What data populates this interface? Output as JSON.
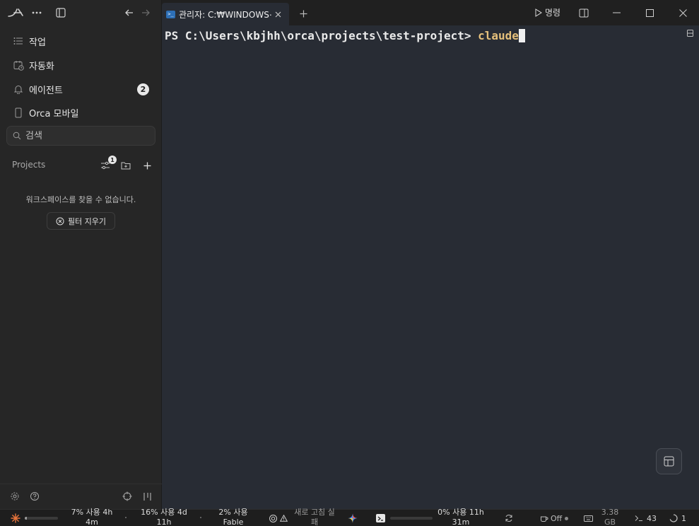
{
  "window": {
    "tab_title": "관리자: C:₩WINDOWS⋯",
    "run_label": "명령"
  },
  "sidebar": {
    "items": [
      {
        "label": "작업",
        "icon": "list-icon"
      },
      {
        "label": "자동화",
        "icon": "calendar-clock-icon"
      },
      {
        "label": "에이전트",
        "icon": "bell-icon",
        "badge": "2"
      },
      {
        "label": "Orca 모바일",
        "icon": "mobile-icon"
      }
    ],
    "search_placeholder": "검색",
    "projects_label": "Projects",
    "filter_badge": "1",
    "empty_message": "워크스페이스를 찾을 수 없습니다.",
    "clear_filter_label": "필터 지우기"
  },
  "terminal": {
    "prompt": "PS C:\\Users\\kbjhh\\orca\\projects\\test-project> ",
    "command": "claude"
  },
  "statusbar": {
    "usage1_line1": "7% 사용 4h",
    "usage1_line2": "4m",
    "usage1_fill": 0.07,
    "usage2_line1": "16% 사용 4d",
    "usage2_line2": "11h",
    "usage3_line1": "2% 사용",
    "usage3_line2": "Fable",
    "refresh_fail_line1": "새로 고침 실",
    "refresh_fail_line2": "패",
    "usage4_line1": "0% 사용 11h",
    "usage4_line2": "31m",
    "power_label": "Off",
    "memory_line1": "3.38",
    "memory_line2": "GB",
    "terminals_count": "43",
    "sessions_count": "1",
    "colors": {
      "accent_orange": "#e8743b",
      "terminal_bg": "#282c34",
      "command_yellow": "#e5c07b"
    }
  }
}
